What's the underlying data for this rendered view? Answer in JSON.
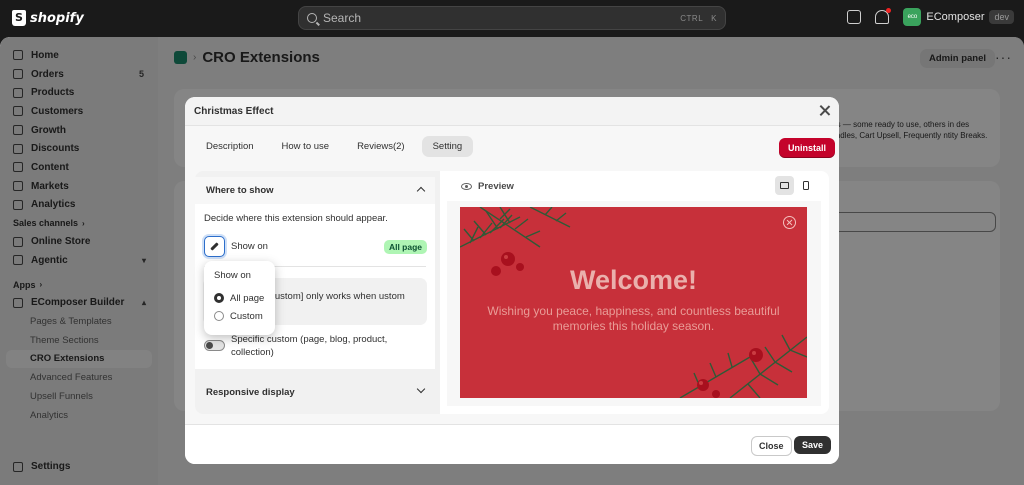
{
  "topbar": {
    "brand": "shopify",
    "search_placeholder": "Search",
    "search_shortcut_1": "CTRL",
    "search_shortcut_2": "K",
    "store_initials": "eco",
    "store_name": "EComposer",
    "store_badge": "dev"
  },
  "sidebar": {
    "items": [
      {
        "label": "Home"
      },
      {
        "label": "Orders",
        "count": "5"
      },
      {
        "label": "Products"
      },
      {
        "label": "Customers"
      },
      {
        "label": "Growth"
      },
      {
        "label": "Discounts"
      },
      {
        "label": "Content"
      },
      {
        "label": "Markets"
      },
      {
        "label": "Analytics"
      }
    ],
    "sales_channels_label": "Sales channels",
    "channels": [
      {
        "label": "Online Store"
      },
      {
        "label": "Agentic"
      }
    ],
    "apps_label": "Apps",
    "app_name": "EComposer Builder",
    "app_subitems": [
      {
        "label": "Pages & Templates"
      },
      {
        "label": "Theme Sections"
      },
      {
        "label": "CRO Extensions"
      },
      {
        "label": "Advanced Features"
      },
      {
        "label": "Upsell Funnels"
      },
      {
        "label": "Analytics"
      }
    ],
    "settings_label": "Settings"
  },
  "page": {
    "title": "CRO Extensions",
    "admin_panel": "Admin panel",
    "bg_text": "ions — some ready to use, others in des Bundles, Cart Upsell, Frequently ntity Breaks."
  },
  "modal": {
    "title": "Christmas Effect",
    "tabs": [
      {
        "label": "Description"
      },
      {
        "label": "How to use"
      },
      {
        "label": "Reviews(2)"
      },
      {
        "label": "Setting"
      }
    ],
    "uninstall": "Uninstall",
    "where_to_show": "Where to show",
    "description": "Decide where this extension should appear.",
    "show_on_label": "Show on",
    "show_on_badge": "All page",
    "info_text": "fic custom] only works when ustom",
    "specific_custom": "Specific custom (page, blog, product, collection)",
    "responsive_display": "Responsive display",
    "preview_label": "Preview",
    "popover": {
      "title": "Show on",
      "options": [
        {
          "label": "All page",
          "selected": true
        },
        {
          "label": "Custom",
          "selected": false
        }
      ]
    },
    "banner": {
      "heading": "Welcome!",
      "subtext": "Wishing you peace, happiness, and countless beautiful memories this holiday season.",
      "bg_color": "#c7303a"
    },
    "footer": {
      "close": "Close",
      "save": "Save"
    }
  },
  "colors": {
    "uninstall": "#c4032b",
    "badge": "#aff5b4",
    "focus": "#2c6ecb"
  }
}
